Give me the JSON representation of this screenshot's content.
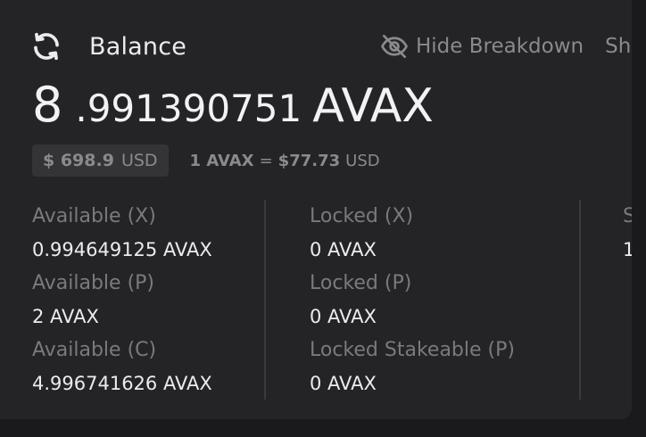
{
  "header": {
    "title": "Balance",
    "refresh_icon": "refresh-icon",
    "hide_label": "Hide Breakdown",
    "hide_icon": "eye-slash-icon",
    "show_label_partial": "Sh"
  },
  "balance": {
    "integer": "8",
    "decimal": ".991390751",
    "unit": "AVAX"
  },
  "price": {
    "usd_amount": "$ 698.9",
    "usd_currency": "USD",
    "rate_lhs": "1 AVAX",
    "rate_eq": "=",
    "rate_rhs": "$77.73",
    "rate_currency": "USD"
  },
  "breakdown": {
    "col1": [
      {
        "label": "Available (X)",
        "value": "0.994649125 AVAX"
      },
      {
        "label": "Available (P)",
        "value": "2 AVAX"
      },
      {
        "label": "Available (C)",
        "value": "4.996741626 AVAX"
      }
    ],
    "col2": [
      {
        "label": "Locked (X)",
        "value": "0 AVAX"
      },
      {
        "label": "Locked (P)",
        "value": "0 AVAX"
      },
      {
        "label": "Locked Stakeable (P)",
        "value": "0 AVAX"
      }
    ],
    "col3": [
      {
        "label": "S",
        "value": "1"
      }
    ]
  },
  "colors": {
    "background": "#242426",
    "text_primary": "#ececee",
    "text_muted": "#8a8a8e",
    "pill_bg": "#343437"
  }
}
